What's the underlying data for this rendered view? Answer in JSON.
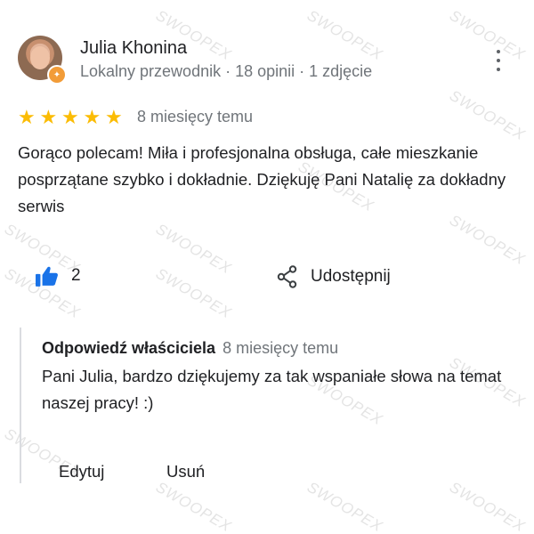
{
  "reviewer": {
    "name": "Julia Khonina",
    "meta": "Lokalny przewodnik · 18 opinii · 1 zdjęcie"
  },
  "review": {
    "rating": 5,
    "date": "8 miesięcy temu",
    "text": "Gorąco polecam! Miła i profesjonalna obsługa, całe mieszkanie posprzątane szybko i dokładnie. Dziękuję Pani Natalię za dokładny serwis"
  },
  "actions": {
    "like_count": "2",
    "share_label": "Udostępnij"
  },
  "owner_reply": {
    "title": "Odpowiedź właściciela",
    "date": "8 miesięcy temu",
    "text": "Pani Julia, bardzo dziękujemy za tak wspaniałe słowa na temat naszej pracy! :)"
  },
  "reply_actions": {
    "edit_label": "Edytuj",
    "delete_label": "Usuń"
  },
  "watermark": "SWOOPEX",
  "colors": {
    "star": "#fbbc04",
    "like_icon": "#1a73e8",
    "secondary_text": "#70757a",
    "badge": "#f29c38"
  },
  "icons": [
    "star-icon",
    "thumbs-up-icon",
    "share-icon",
    "more-vert-icon",
    "local-guide-badge-icon"
  ]
}
